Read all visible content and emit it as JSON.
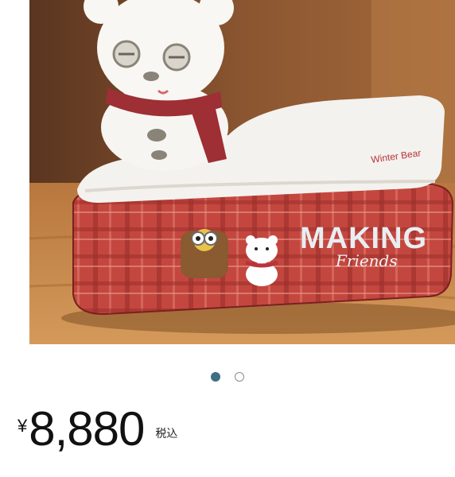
{
  "product_image": {
    "alt": "Plush tissue box cover with snowman and embroidered MAKING Friends patch",
    "patch_title": "MAKING",
    "patch_script": "Friends",
    "tag_text": "Winter Bear"
  },
  "carousel": {
    "total": 2,
    "active_index": 0
  },
  "price": {
    "currency_symbol": "¥",
    "amount": "8,880",
    "tax_label": "税込"
  }
}
